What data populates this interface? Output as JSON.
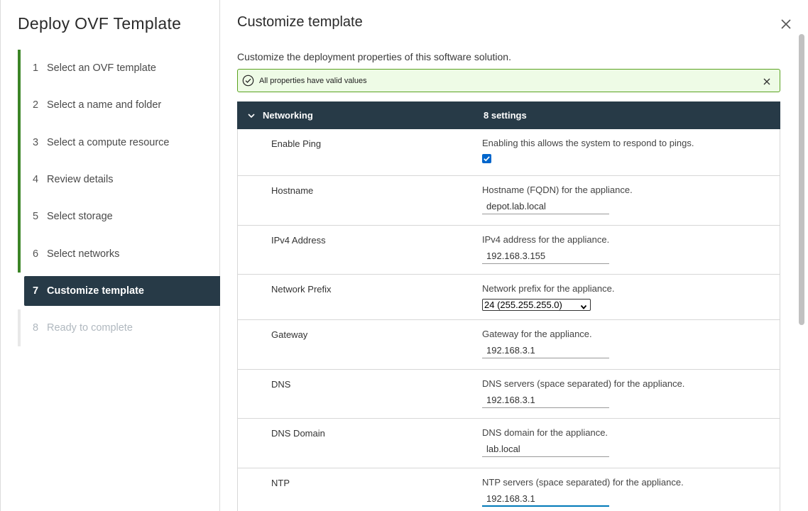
{
  "nav": {
    "title": "Deploy OVF Template",
    "steps": [
      {
        "num": "1",
        "label": "Select an OVF template"
      },
      {
        "num": "2",
        "label": "Select a name and folder"
      },
      {
        "num": "3",
        "label": "Select a compute resource"
      },
      {
        "num": "4",
        "label": "Review details"
      },
      {
        "num": "5",
        "label": "Select storage"
      },
      {
        "num": "6",
        "label": "Select networks"
      },
      {
        "num": "7",
        "label": "Customize template"
      },
      {
        "num": "8",
        "label": "Ready to complete"
      }
    ],
    "active_step": 7
  },
  "main": {
    "title": "Customize template",
    "subtitle": "Customize the deployment properties of this software solution.",
    "alert": "All properties have valid values",
    "group": {
      "name": "Networking",
      "count": "8 settings"
    },
    "rows": {
      "enable_ping": {
        "label": "Enable Ping",
        "desc": "Enabling this allows the system to respond to pings.",
        "checked": true
      },
      "hostname": {
        "label": "Hostname",
        "desc": "Hostname (FQDN) for the appliance.",
        "value": "depot.lab.local"
      },
      "ipv4": {
        "label": "IPv4 Address",
        "desc": "IPv4 address for the appliance.",
        "value": "192.168.3.155"
      },
      "prefix": {
        "label": "Network Prefix",
        "desc": "Network prefix for the appliance.",
        "value": "24 (255.255.255.0)"
      },
      "gateway": {
        "label": "Gateway",
        "desc": "Gateway for the appliance.",
        "value": "192.168.3.1"
      },
      "dns": {
        "label": "DNS",
        "desc": "DNS servers (space separated) for the appliance.",
        "value": "192.168.3.1"
      },
      "dns_domain": {
        "label": "DNS Domain",
        "desc": "DNS domain for the appliance.",
        "value": "lab.local"
      },
      "ntp": {
        "label": "NTP",
        "desc": "NTP servers (space separated) for the appliance.",
        "value": "192.168.3.1"
      }
    }
  },
  "colors": {
    "accent_green": "#3c8527",
    "nav_active_bg": "#273a47",
    "alert_bg": "#eefbe6",
    "alert_border": "#5aa220",
    "focus_blue": "#0079b8"
  },
  "icons": {
    "close": "close-icon",
    "alert_ok": "check-circle-icon",
    "alert_close": "close-icon",
    "group_toggle": "chevron-down-icon",
    "select_caret": "chevron-down-icon",
    "checkbox": "checkbox-checked-icon"
  }
}
